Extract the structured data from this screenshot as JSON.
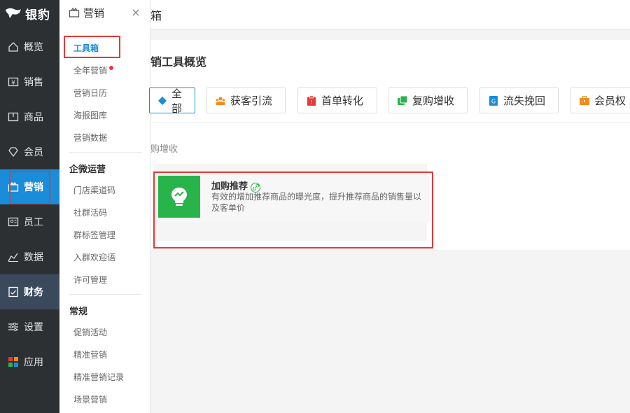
{
  "brand": {
    "name": "银豹"
  },
  "nav": [
    {
      "label": "概览",
      "icon": "overview-icon"
    },
    {
      "label": "销售",
      "icon": "sales-icon"
    },
    {
      "label": "商品",
      "icon": "goods-icon"
    },
    {
      "label": "会员",
      "icon": "member-icon"
    },
    {
      "label": "营销",
      "icon": "marketing-icon"
    },
    {
      "label": "员工",
      "icon": "staff-icon"
    },
    {
      "label": "数据",
      "icon": "data-icon"
    },
    {
      "label": "财务",
      "icon": "finance-icon"
    },
    {
      "label": "设置",
      "icon": "settings-icon"
    },
    {
      "label": "应用",
      "icon": "apps-icon"
    }
  ],
  "submenu": {
    "title": "营销",
    "close": "×",
    "items_top": [
      "工具箱",
      "全年营销",
      "营销日历",
      "海报图库",
      "营销数据"
    ],
    "group_wechat": "企微运营",
    "items_wechat": [
      "门店渠道码",
      "社群活码",
      "群标签管理",
      "入群欢迎语",
      "许可管理"
    ],
    "group_general": "常规",
    "items_general": [
      "促销活动",
      "精准营销",
      "精准营销记录",
      "场景营销"
    ]
  },
  "topbar": {
    "title": "箱"
  },
  "main": {
    "page_title": "销工具概览",
    "filters": [
      {
        "label": "全部",
        "color": "#1a8cd8"
      },
      {
        "label": "获客引流",
        "color": "#f08c1e"
      },
      {
        "label": "首单转化",
        "color": "#e53935"
      },
      {
        "label": "复购增收",
        "color": "#28b44b"
      },
      {
        "label": "流失挽回",
        "color": "#1a8cd8"
      },
      {
        "label": "会员权",
        "color": "#f08c1e"
      }
    ],
    "section_label": "购增收",
    "tool": {
      "name": "加购推荐",
      "desc": "有效的增加推荐商品的曝光度，提升推荐商品的销售量以及客单价"
    }
  },
  "colors": {
    "accent": "#1a8cd8",
    "highlight": "#e53935",
    "tool_green": "#28b44b"
  }
}
